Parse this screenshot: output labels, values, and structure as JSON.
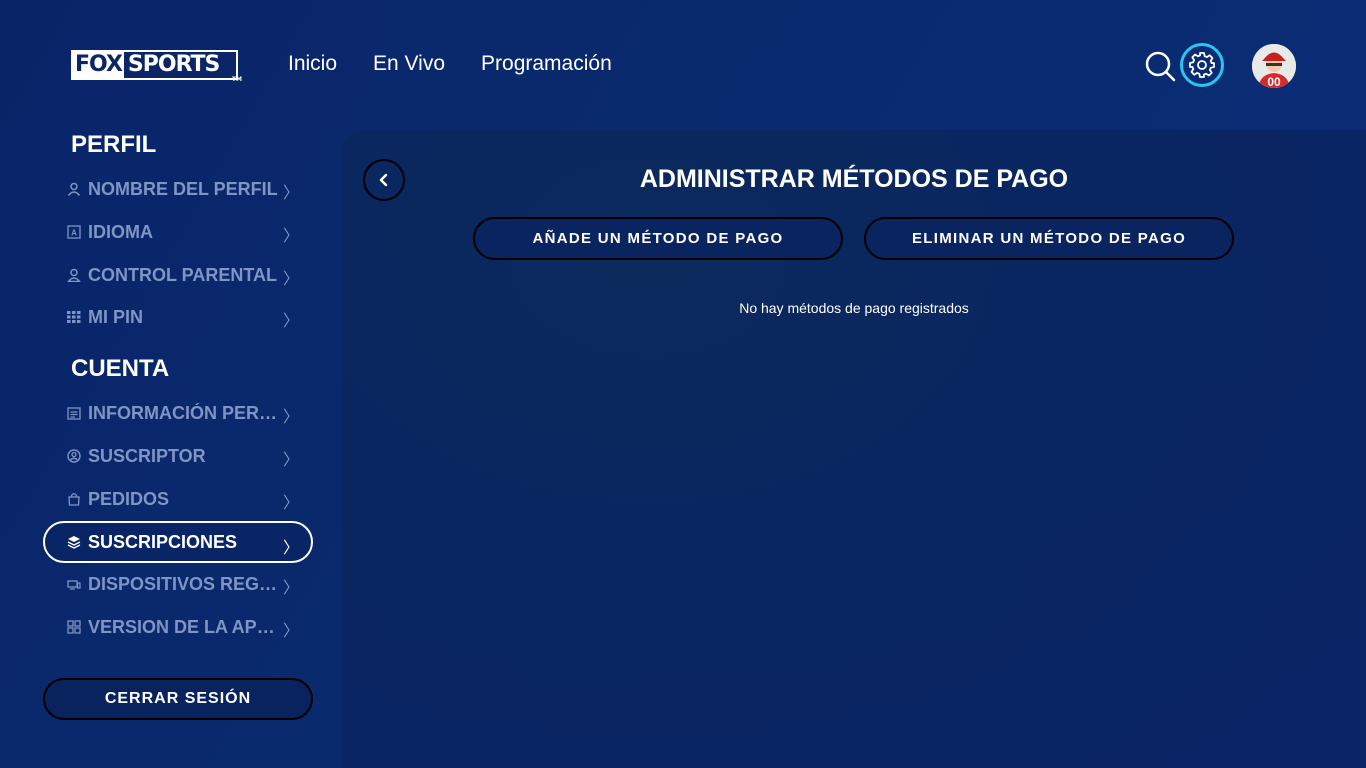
{
  "brand": {
    "logo_fox": "FOX",
    "logo_sports": "SPORTS",
    "logo_tm": "TM"
  },
  "nav": {
    "items": [
      {
        "label": "Inicio"
      },
      {
        "label": "En Vivo"
      },
      {
        "label": "Programación"
      }
    ]
  },
  "header_icons": {
    "search": "search-icon",
    "settings": "gear-icon",
    "accent_color": "#29c4f0"
  },
  "sidebar": {
    "profile_title": "PERFIL",
    "profile_items": [
      {
        "label": "NOMBRE DEL PERFIL",
        "icon": "user-icon"
      },
      {
        "label": "IDIOMA",
        "icon": "language-icon"
      },
      {
        "label": "CONTROL PARENTAL",
        "icon": "parental-icon"
      },
      {
        "label": "MI PIN",
        "icon": "keypad-icon"
      }
    ],
    "account_title": "CUENTA",
    "account_items": [
      {
        "label": "INFORMACIÓN PERSONAL",
        "icon": "document-icon"
      },
      {
        "label": "SUSCRIPTOR",
        "icon": "user-circle-icon"
      },
      {
        "label": "PEDIDOS",
        "icon": "bag-icon"
      },
      {
        "label": "SUSCRIPCIONES",
        "icon": "layers-icon",
        "active": true
      },
      {
        "label": "DISPOSITIVOS REGISTRADOS",
        "icon": "devices-icon"
      },
      {
        "label": "VERSION DE LA APLICACIÓN",
        "icon": "apps-icon"
      }
    ],
    "logout_label": "CERRAR SESIÓN"
  },
  "main": {
    "title": "ADMINISTRAR MÉTODOS DE PAGO",
    "add_button": "AÑADE UN MÉTODO DE PAGO",
    "remove_button": "ELIMINAR UN MÉTODO DE PAGO",
    "empty_message": "No hay métodos de pago registrados"
  }
}
